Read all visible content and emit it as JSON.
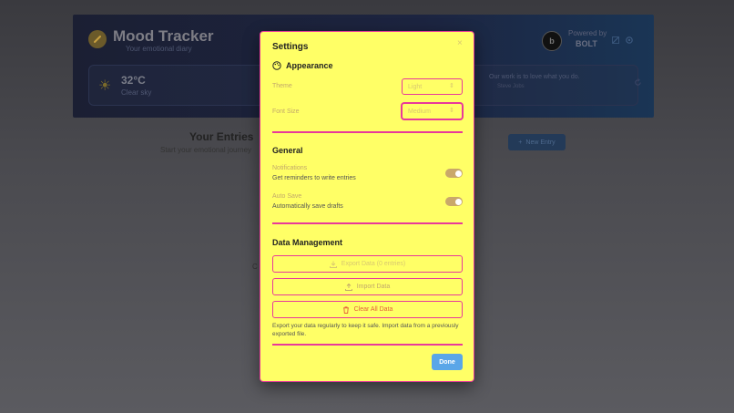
{
  "app": {
    "title": "Mood Tracker",
    "subtitle": "Your emotional diary",
    "powered_by": "Powered by",
    "brand": "BOLT",
    "brand_badge": "b"
  },
  "weather": {
    "icon": "sun-icon",
    "temperature": "32°C",
    "condition": "Clear sky"
  },
  "quote": {
    "text": "Our work is to love what you do.",
    "author": "Steve Jobs"
  },
  "entries": {
    "title": "Your Entries",
    "subtitle": "Start your emotional journey",
    "new_entry_label": "New Entry",
    "stray_char": "C"
  },
  "settings": {
    "title": "Settings",
    "close_label": "×",
    "appearance": {
      "title": "Appearance",
      "theme_label": "Theme",
      "theme_value": "Light",
      "font_size_label": "Font Size",
      "font_size_value": "Medium"
    },
    "general": {
      "title": "General",
      "notifications_label": "Notifications",
      "notifications_desc": "Get reminders to write entries",
      "notifications_on": true,
      "auto_save_label": "Auto Save",
      "auto_save_desc": "Automatically save drafts",
      "auto_save_on": true
    },
    "data": {
      "title": "Data Management",
      "export_label": "Export Data (0 entries)",
      "import_label": "Import Data",
      "clear_label": "Clear All Data",
      "note": "Export your data regularly to keep it safe. Import data from a previously exported file."
    },
    "done_label": "Done"
  },
  "colors": {
    "modal_bg": "#ffff66",
    "modal_border": "#e8399a",
    "done_button": "#5aa6e8",
    "danger": "#e2603a"
  }
}
